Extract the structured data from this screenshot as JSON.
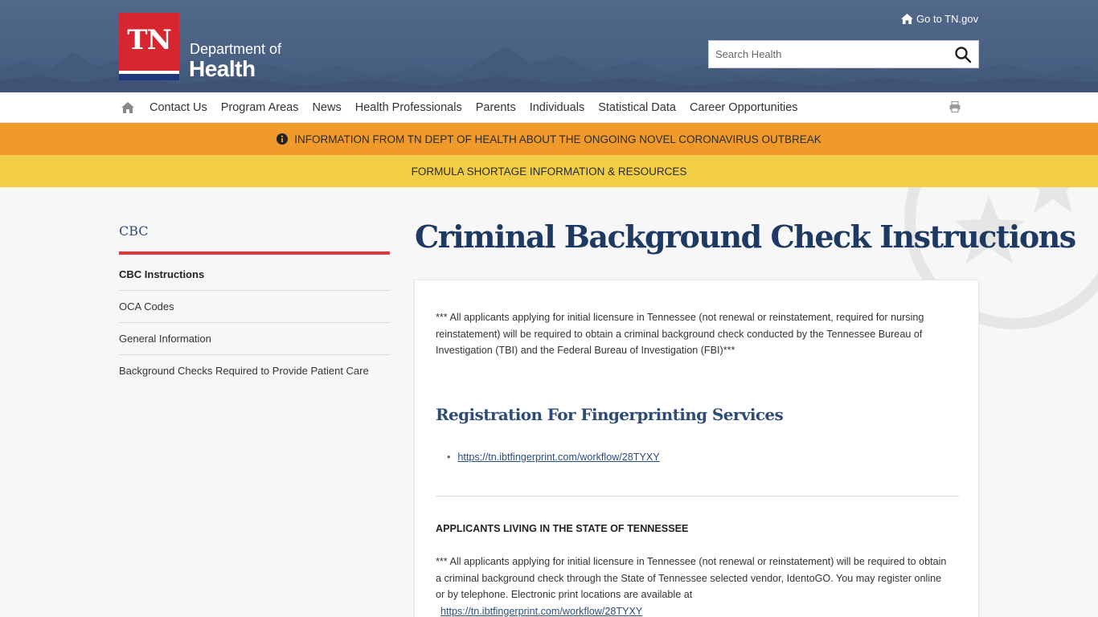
{
  "header": {
    "logo_text": "TN",
    "dept_line": "Department of",
    "dept_name": "Health",
    "go_tn_label": "Go to TN.gov",
    "search_placeholder": "Search Health"
  },
  "nav": {
    "items": [
      "Contact Us",
      "Program Areas",
      "News",
      "Health Professionals",
      "Parents",
      "Individuals",
      "Statistical Data",
      "Career Opportunities"
    ]
  },
  "banners": {
    "covid": "INFORMATION FROM TN DEPT OF HEALTH ABOUT THE ONGOING NOVEL CORONAVIRUS OUTBREAK",
    "formula": "FORMULA SHORTAGE INFORMATION & RESOURCES"
  },
  "sidebar": {
    "title": "CBC",
    "items": [
      "CBC Instructions",
      "OCA Codes",
      "General Information",
      "Background Checks Required to Provide Patient Care"
    ]
  },
  "main": {
    "title": "Criminal Background Check Instructions",
    "intro": "*** All applicants applying for initial licensure in Tennessee (not renewal or reinstatement, required for nursing reinstatement) will be required to obtain a criminal background check conducted by the Tennessee Bureau of Investigation (TBI) and the Federal Bureau of Investigation (FBI)***",
    "reg_heading": "Registration For Fingerprinting Services",
    "reg_link": "https://tn.ibtfingerprint.com/workflow/28TYXY",
    "tn_heading": "APPLICANTS LIVING IN THE STATE OF TENNESSEE",
    "tn_text": "*** All applicants applying for initial licensure in Tennessee (not renewal or reinstatement) will be required to obtain a criminal background check through the State of Tennessee selected vendor, IdentoGO.   You may register online or by telephone.  Electronic print locations are available at",
    "tn_link": "https://tn.ibtfingerprint.com/workflow/28TYXY"
  },
  "colors": {
    "header_bg": "#4a6184",
    "logo_red": "#d7262f",
    "banner_orange": "#f09a2b",
    "banner_yellow": "#f2cd46",
    "title_navy": "#1e3a63",
    "sidebar_rule": "#e1393b"
  },
  "icons": [
    "home-icon",
    "search-icon",
    "print-icon",
    "info-circle-icon",
    "tn-star-watermark-icon"
  ]
}
